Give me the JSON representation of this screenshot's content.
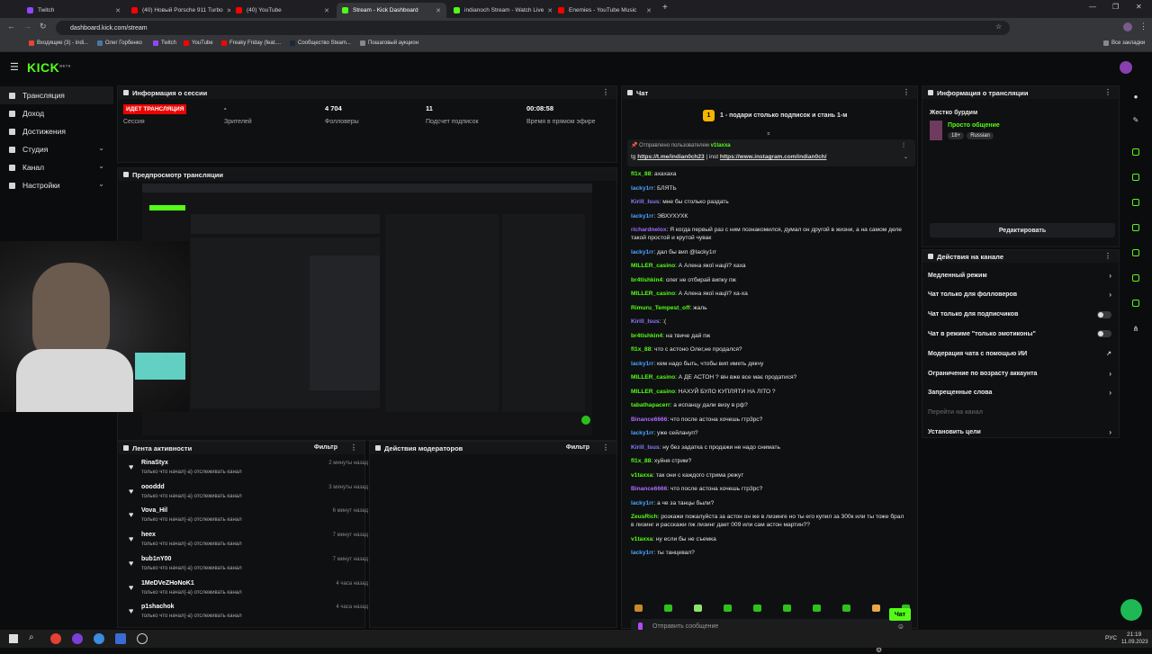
{
  "browser": {
    "tabs": [
      {
        "label": "Twitch",
        "color": "#9146ff"
      },
      {
        "label": "(40) Новый Porsche 911 Turbo",
        "color": "#ff0000"
      },
      {
        "label": "(40) YouTube",
        "color": "#ff0000"
      },
      {
        "label": "Stream - Kick Dashboard",
        "color": "#53fc18"
      },
      {
        "label": "indianoch Stream - Watch Live",
        "color": "#53fc18"
      },
      {
        "label": "Enemies - YouTube Music",
        "color": "#ff0000"
      }
    ],
    "url": "dashboard.kick.com/stream",
    "bookmarks": [
      "Входящие (3) - indi...",
      "Олег Горбенко",
      "Twitch",
      "YouTube",
      "Freaky Friday (feat....",
      "Сообщество Steam...",
      "Пошаговый аукцион"
    ],
    "all_bookmarks": "Все закладки"
  },
  "app": {
    "logo": "KICK",
    "logo_badge": "BETA"
  },
  "sidebar": {
    "items": [
      {
        "label": "Трансляция",
        "chevron": false
      },
      {
        "label": "Доход",
        "chevron": false
      },
      {
        "label": "Достижения",
        "chevron": false
      },
      {
        "label": "Студия",
        "chevron": true
      },
      {
        "label": "Канал",
        "chevron": true
      },
      {
        "label": "Настройки",
        "chevron": true
      }
    ]
  },
  "session": {
    "title": "Информация о сессии",
    "status": "ИДЕТ ТРАНСЛЯЦИЯ",
    "status_label": "Сессия",
    "stats": [
      {
        "value": "-",
        "label": "Зрителей"
      },
      {
        "value": "4 704",
        "label": "Фолловеры"
      },
      {
        "value": "11",
        "label": "Подсчет подписок"
      },
      {
        "value": "00:08:58",
        "label": "Время в прямом эфире"
      }
    ]
  },
  "preview": {
    "title": "Предпросмотр трансляции"
  },
  "activity": {
    "title": "Лента активности",
    "filter": "Фильтр",
    "items": [
      {
        "name": "RinaStyx",
        "desc": "только что начал(-а) отслеживать канал",
        "time": "2 минуты назад"
      },
      {
        "name": "oooddd",
        "desc": "только что начал(-а) отслеживать канал",
        "time": "3 минуты назад"
      },
      {
        "name": "Vova_Hil",
        "desc": "только что начал(-а) отслеживать канал",
        "time": "6 минут назад"
      },
      {
        "name": "heex",
        "desc": "только что начал(-а) отслеживать канал",
        "time": "7 минут назад"
      },
      {
        "name": "bub1nY00",
        "desc": "только что начал(-а) отслеживать канал",
        "time": "7 минут назад"
      },
      {
        "name": "1MeDVeZHoNoK1",
        "desc": "только что начал(-а) отслеживать канал",
        "time": "4 часа назад"
      },
      {
        "name": "p1shachok",
        "desc": "только что начал(-а) отслеживать канал",
        "time": "4 часа назад"
      }
    ]
  },
  "moderators": {
    "title": "Действия модераторов",
    "filter": "Фильтр"
  },
  "chat": {
    "title": "Чат",
    "goal_number": "1",
    "goal_text": "1 - подари столько подписок и стань 1-м",
    "pinned_by": "Отправлено пользователем",
    "pinned_user": "v1taxxa",
    "pinned_text_prefix": "tg",
    "pinned_link1": "https://t.me/indian0ch23",
    "pinned_sep": "| inst",
    "pinned_link2": "https://www.instagram.com/indian0ch/",
    "messages": [
      {
        "user": "fl1x_88",
        "color": "#53fc18",
        "text": "ахахаха"
      },
      {
        "user": "lacky1rr",
        "color": "#4aa3ff",
        "text": "БЛЯТЬ"
      },
      {
        "user": "Kirill_Isus",
        "color": "#8a7dff",
        "text": "мне бы столько раздать"
      },
      {
        "user": "lacky1rr",
        "color": "#4aa3ff",
        "text": "ЭВХУХУХК"
      },
      {
        "user": "richardnelox",
        "color": "#9f6bff",
        "text": "Я когда первый раз с ним познакомился, думал он другой в жизни, а на самом деле такой простой и крутой чувак"
      },
      {
        "user": "lacky1rr",
        "color": "#4aa3ff",
        "text": "дал бы вип @lacky1rr"
      },
      {
        "user": "MILLER_casino",
        "color": "#53fc18",
        "text": "А Алена якої нації? хаха"
      },
      {
        "user": "br4tishkin4",
        "color": "#53fc18",
        "text": "олег не отбирай випку пж"
      },
      {
        "user": "MILLER_casino",
        "color": "#53fc18",
        "text": "А Алена якої нації? ха-ха"
      },
      {
        "user": "Rimuru_Tempest_off",
        "color": "#53fc18",
        "text": "жаль"
      },
      {
        "user": "Kirill_Isus",
        "color": "#8a7dff",
        "text": ":("
      },
      {
        "user": "br4tishkin4",
        "color": "#53fc18",
        "text": "на твиче дай пж"
      },
      {
        "user": "fl1x_88",
        "color": "#53fc18",
        "text": "что с астоно Олег,не продался?"
      },
      {
        "user": "lacky1rr",
        "color": "#4aa3ff",
        "text": "кем надо быть, чтобы вип иметь дякчу"
      },
      {
        "user": "MILLER_casino",
        "color": "#53fc18",
        "text": "А ДЕ АСТОН ? він вже все має продатися?"
      },
      {
        "user": "MILLER_casino",
        "color": "#53fc18",
        "text": "НАХУЙ БУЛО КУПЛЯТИ НА ЛІТО ?"
      },
      {
        "user": "tabathapacerr",
        "color": "#53fc18",
        "text": "а испанцу дали визу в рф?"
      },
      {
        "user": "Binance6666",
        "color": "#b06bff",
        "text": "что после астона хочешь гтр3рс?"
      },
      {
        "user": "lacky1rr",
        "color": "#4aa3ff",
        "text": "уже сейлануп?"
      },
      {
        "user": "Kirill_Isus",
        "color": "#8a7dff",
        "text": "ну без задатка с продажи не надо снимать"
      },
      {
        "user": "fl1x_88",
        "color": "#53fc18",
        "text": "хуйня стрим?"
      },
      {
        "user": "v1taxxa",
        "color": "#53fc18",
        "text": "так они с каждого стрима режут"
      },
      {
        "user": "Binance6666",
        "color": "#b06bff",
        "text": "что после астона хочешь гтр3рс?"
      },
      {
        "user": "lacky1rr",
        "color": "#4aa3ff",
        "text": "а че за танцы были?"
      },
      {
        "user": "ZeusRich",
        "color": "#53fc18",
        "text": "розкажи пожалуйста за астон он же в лизинге но ты его купил за 300к или ты тоже брал в лизинг и расскажи пж лизинг дает 009 или сам астон мартин??"
      },
      {
        "user": "v1taxxa",
        "color": "#53fc18",
        "text": "ну если бы не съемка"
      },
      {
        "user": "lacky1rr",
        "color": "#4aa3ff",
        "text": "ты танцевал?"
      }
    ],
    "input_placeholder": "Отправить сообщение",
    "send_label": "Чат"
  },
  "stream_info": {
    "title": "Информация о трансляции",
    "stream_title": "Жестко бурдим",
    "category": "Просто общение",
    "tags": [
      "18+",
      "Russian"
    ],
    "edit_label": "Редактировать"
  },
  "channel_actions": {
    "title": "Действия на канале",
    "items": [
      {
        "label": "Медленный режим",
        "control": "chevron"
      },
      {
        "label": "Чат только для фолловеров",
        "control": "chevron"
      },
      {
        "label": "Чат только для подписчиков",
        "control": "toggle"
      },
      {
        "label": "Чат в режиме \"только эмотиконы\"",
        "control": "toggle"
      },
      {
        "label": "Модерация чата с помощью ИИ",
        "control": "external"
      },
      {
        "label": "Ограничение по возрасту аккаунта",
        "control": "chevron"
      },
      {
        "label": "Запрещенные слова",
        "control": "chevron"
      },
      {
        "label": "Перейти на канал",
        "control": "none"
      },
      {
        "label": "Установить цели",
        "control": "chevron"
      }
    ]
  },
  "taskbar": {
    "lang": "РУС",
    "time": "21:19",
    "date": "11.09.2023"
  },
  "colors": {
    "accent": "#53fc18",
    "live": "#eb0400",
    "panel": "#0f1011"
  }
}
